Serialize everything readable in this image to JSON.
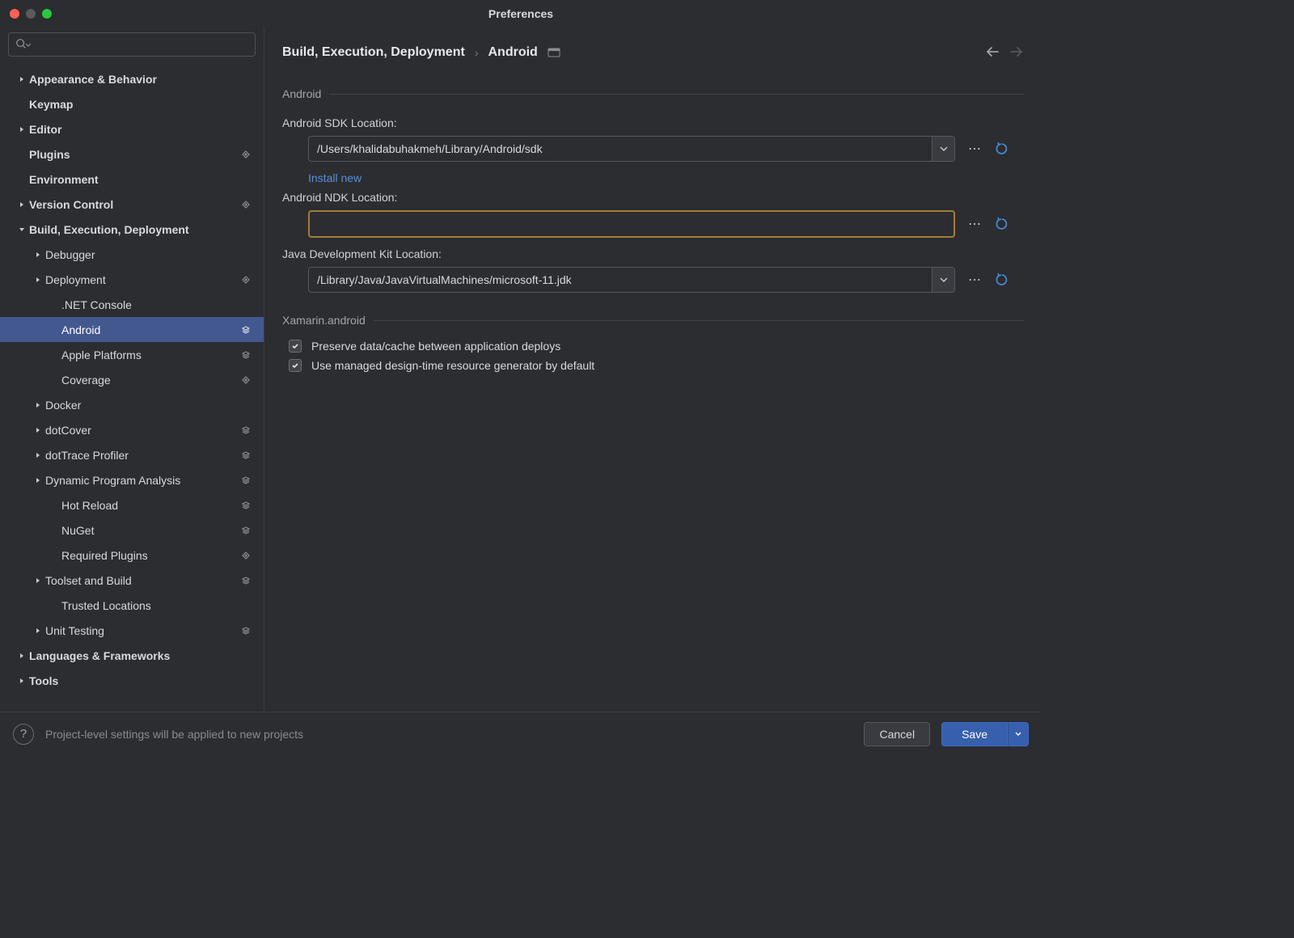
{
  "window": {
    "title": "Preferences"
  },
  "search": {
    "placeholder": ""
  },
  "sidebar": {
    "items": [
      {
        "label": "Appearance & Behavior",
        "bold": true,
        "depth": 0,
        "chevron": "right",
        "indicator": null
      },
      {
        "label": "Keymap",
        "bold": true,
        "depth": 0,
        "chevron": null,
        "indicator": null
      },
      {
        "label": "Editor",
        "bold": true,
        "depth": 0,
        "chevron": "right",
        "indicator": null
      },
      {
        "label": "Plugins",
        "bold": true,
        "depth": 0,
        "chevron": null,
        "indicator": "dot"
      },
      {
        "label": "Environment",
        "bold": true,
        "depth": 0,
        "chevron": null,
        "indicator": null
      },
      {
        "label": "Version Control",
        "bold": true,
        "depth": 0,
        "chevron": "right",
        "indicator": "dot"
      },
      {
        "label": "Build, Execution, Deployment",
        "bold": true,
        "depth": 0,
        "chevron": "down",
        "indicator": null
      },
      {
        "label": "Debugger",
        "bold": false,
        "depth": 1,
        "chevron": "right",
        "indicator": null
      },
      {
        "label": "Deployment",
        "bold": false,
        "depth": 1,
        "chevron": "right",
        "indicator": "dot"
      },
      {
        "label": ".NET Console",
        "bold": false,
        "depth": 2,
        "chevron": null,
        "indicator": null
      },
      {
        "label": "Android",
        "bold": false,
        "depth": 2,
        "chevron": null,
        "indicator": "layers",
        "selected": true
      },
      {
        "label": "Apple Platforms",
        "bold": false,
        "depth": 2,
        "chevron": null,
        "indicator": "layers"
      },
      {
        "label": "Coverage",
        "bold": false,
        "depth": 2,
        "chevron": null,
        "indicator": "dot"
      },
      {
        "label": "Docker",
        "bold": false,
        "depth": 1,
        "chevron": "right",
        "indicator": null
      },
      {
        "label": "dotCover",
        "bold": false,
        "depth": 1,
        "chevron": "right",
        "indicator": "layers"
      },
      {
        "label": "dotTrace Profiler",
        "bold": false,
        "depth": 1,
        "chevron": "right",
        "indicator": "layers"
      },
      {
        "label": "Dynamic Program Analysis",
        "bold": false,
        "depth": 1,
        "chevron": "right",
        "indicator": "layers"
      },
      {
        "label": "Hot Reload",
        "bold": false,
        "depth": 2,
        "chevron": null,
        "indicator": "layers"
      },
      {
        "label": "NuGet",
        "bold": false,
        "depth": 2,
        "chevron": null,
        "indicator": "layers"
      },
      {
        "label": "Required Plugins",
        "bold": false,
        "depth": 2,
        "chevron": null,
        "indicator": "dot"
      },
      {
        "label": "Toolset and Build",
        "bold": false,
        "depth": 1,
        "chevron": "right",
        "indicator": "layers"
      },
      {
        "label": "Trusted Locations",
        "bold": false,
        "depth": 2,
        "chevron": null,
        "indicator": null
      },
      {
        "label": "Unit Testing",
        "bold": false,
        "depth": 1,
        "chevron": "right",
        "indicator": "layers"
      },
      {
        "label": "Languages & Frameworks",
        "bold": true,
        "depth": 0,
        "chevron": "right",
        "indicator": null
      },
      {
        "label": "Tools",
        "bold": true,
        "depth": 0,
        "chevron": "right",
        "indicator": null
      }
    ]
  },
  "breadcrumb": {
    "parent": "Build, Execution, Deployment",
    "current": "Android"
  },
  "sections": {
    "android": {
      "title": "Android",
      "sdk_label": "Android SDK Location:",
      "sdk_value": "/Users/khalidabuhakmeh/Library/Android/sdk",
      "install_link": "Install new",
      "ndk_label": "Android NDK Location:",
      "ndk_value": "",
      "jdk_label": "Java Development Kit Location:",
      "jdk_value": "/Library/Java/JavaVirtualMachines/microsoft-11.jdk"
    },
    "xamarin": {
      "title": "Xamarin.android",
      "checkbox1": "Preserve data/cache between application deploys",
      "checkbox2": "Use managed design-time resource generator by default"
    }
  },
  "footer": {
    "hint": "Project-level settings will be applied to new projects",
    "cancel": "Cancel",
    "save": "Save"
  }
}
